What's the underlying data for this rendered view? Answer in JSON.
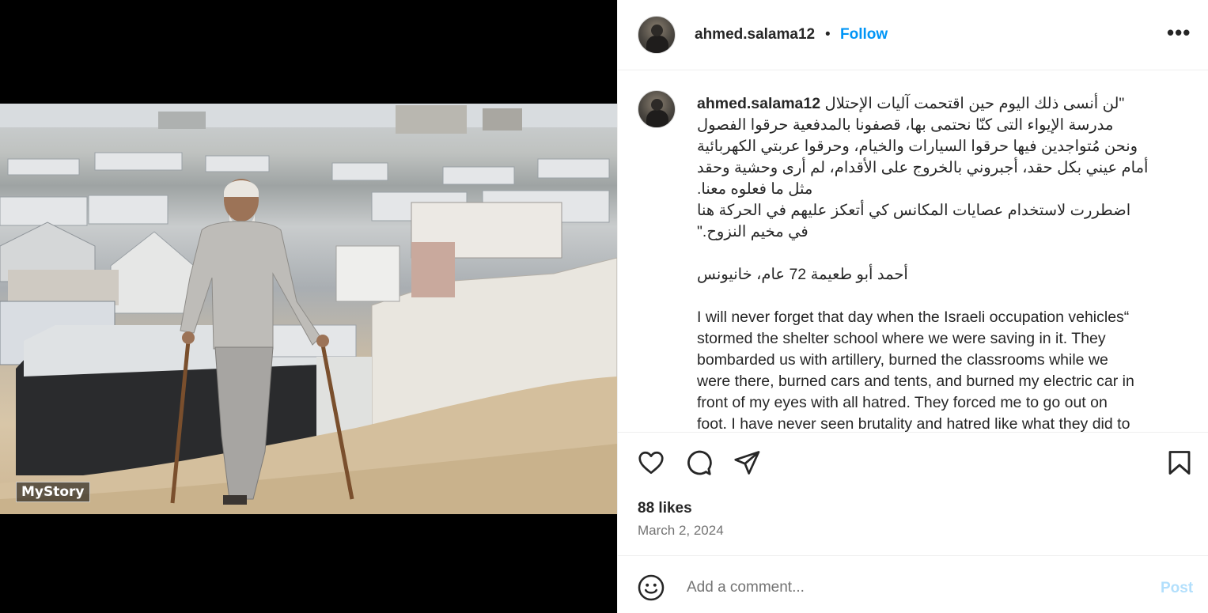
{
  "media": {
    "watermark": "MyStory"
  },
  "header": {
    "username": "ahmed.salama12",
    "separator": "•",
    "follow_label": "Follow",
    "more_label": "•••"
  },
  "caption": {
    "username": "ahmed.salama12",
    "first_line": "\"لن أنسى ذلك اليوم حين اقتحمت آليات الإحتلال",
    "arabic_lines": [
      "مدرسة الإيواء التى كنّا نحتمى بها، قصفونا بالمدفعية حرقوا الفصول",
      "ونحن مُتواجدين فيها حرقوا السيارات والخيام، وحرقوا عربتي الكهربائية",
      "أمام عيني بكل حقد، أجبروني بالخروج على الأقدام، لم أرى وحشية وحقد",
      "مثل ما فعلوه معنا.",
      "اضطررت لاستخدام عصايات المكانس كي أتعكز عليهم في الحركة هنا",
      "في مخيم النزوح.\""
    ],
    "signature": "أحمد أبو طعيمة 72 عام، خانيونس",
    "english_lines": [
      "I will never forget that day when the Israeli occupation vehicles“",
      "stormed the shelter school where we were saving in it. They",
      "bombarded us with artillery, burned the classrooms while we",
      "were there, burned cars and tents, and burned my electric car in",
      "front of my eyes with all hatred. They forced me to go out on",
      "foot. I have never seen brutality and hatred like what they did to"
    ]
  },
  "actions": {
    "icons": [
      "heart-icon",
      "comment-icon",
      "share-icon",
      "bookmark-icon"
    ],
    "likes": "88 likes",
    "date": "March 2, 2024"
  },
  "comment": {
    "placeholder": "Add a comment...",
    "post_label": "Post"
  },
  "colors": {
    "accent": "#0095f6",
    "post_disabled": "#b2dffc",
    "muted_text": "#737373"
  }
}
